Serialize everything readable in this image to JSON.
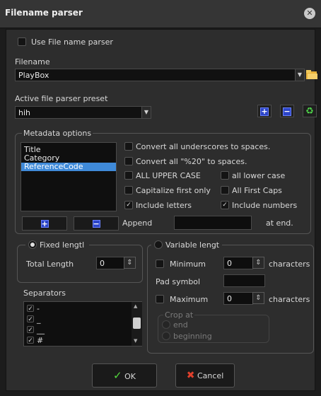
{
  "window": {
    "title": "Filename parser"
  },
  "use_parser": {
    "label": "Use File name parser",
    "checked": false
  },
  "filename": {
    "section_label": "Filename",
    "value": "PlayBox"
  },
  "preset": {
    "section_label": "Active file parser preset",
    "value": "hih"
  },
  "metadata": {
    "legend": "Metadata options",
    "fields": [
      "Title",
      "Category",
      "ReferenceCode"
    ],
    "selected_index": 2,
    "options": {
      "underscores": {
        "label": "Convert all underscores to spaces.",
        "checked": false
      },
      "percent20": {
        "label": "Convert all \"%20\" to spaces.",
        "checked": false
      },
      "upper": {
        "label": "ALL UPPER CASE",
        "checked": false
      },
      "lower": {
        "label": "all lower case",
        "checked": false
      },
      "cap_first": {
        "label": "Capitalize first only",
        "checked": false
      },
      "all_first_caps": {
        "label": "All First Caps",
        "checked": false
      },
      "letters": {
        "label": "Include letters",
        "checked": true
      },
      "numbers": {
        "label": "Include numbers",
        "checked": true
      }
    },
    "append_label": "Append",
    "append_value": "",
    "at_end_label": "at end."
  },
  "fixed": {
    "label": "Fixed lengtl",
    "selected": true,
    "total_label": "Total Length",
    "total_value": "0"
  },
  "variable": {
    "label": "Variable lengt",
    "selected": false,
    "minimum_label": "Minimum",
    "minimum_value": "0",
    "min_chars": "characters",
    "pad_label": "Pad symbol",
    "pad_value": "",
    "maximum_label": "Maximum",
    "maximum_value": "0",
    "max_chars": "characters",
    "crop_legend": "Crop at",
    "crop_end": "end",
    "crop_beginning": "beginning"
  },
  "separators": {
    "label": "Separators",
    "items": [
      "-",
      "_",
      "__",
      "#"
    ]
  },
  "buttons": {
    "ok": "OK",
    "cancel": "Cancel"
  }
}
